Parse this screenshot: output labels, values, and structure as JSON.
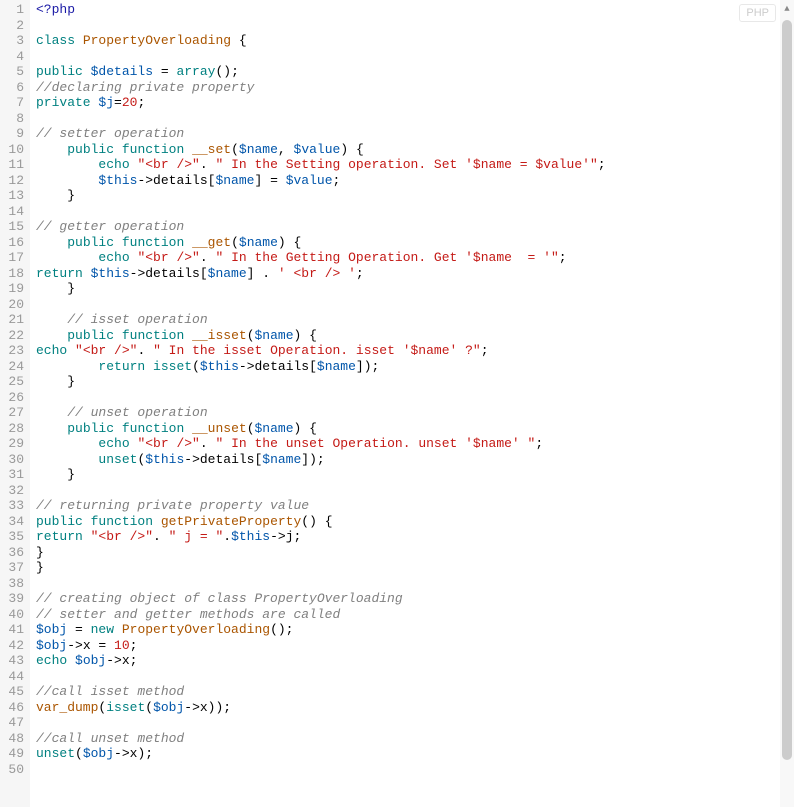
{
  "badge": "PHP",
  "line_count": 50,
  "lines": [
    [
      {
        "c": "t-tag",
        "t": "<?php"
      }
    ],
    [],
    [
      {
        "c": "t-kw",
        "t": "class"
      },
      {
        "t": " "
      },
      {
        "c": "t-fn",
        "t": "PropertyOverloading"
      },
      {
        "t": " {"
      }
    ],
    [],
    [
      {
        "c": "t-kw",
        "t": "public"
      },
      {
        "t": " "
      },
      {
        "c": "t-var",
        "t": "$details"
      },
      {
        "t": " = "
      },
      {
        "c": "t-kw",
        "t": "array"
      },
      {
        "t": "();"
      }
    ],
    [
      {
        "c": "t-com",
        "t": "//declaring private property"
      }
    ],
    [
      {
        "c": "t-kw",
        "t": "private"
      },
      {
        "t": " "
      },
      {
        "c": "t-var",
        "t": "$j"
      },
      {
        "t": "="
      },
      {
        "c": "t-num",
        "t": "20"
      },
      {
        "t": ";"
      }
    ],
    [],
    [
      {
        "c": "t-com",
        "t": "// setter operation"
      }
    ],
    [
      {
        "t": "    "
      },
      {
        "c": "t-kw",
        "t": "public"
      },
      {
        "t": " "
      },
      {
        "c": "t-kw",
        "t": "function"
      },
      {
        "t": " "
      },
      {
        "c": "t-fn",
        "t": "__set"
      },
      {
        "t": "("
      },
      {
        "c": "t-var",
        "t": "$name"
      },
      {
        "t": ", "
      },
      {
        "c": "t-var",
        "t": "$value"
      },
      {
        "t": ") {"
      }
    ],
    [
      {
        "t": "        "
      },
      {
        "c": "t-kw",
        "t": "echo"
      },
      {
        "t": " "
      },
      {
        "c": "t-str",
        "t": "\"<br />\""
      },
      {
        "t": ". "
      },
      {
        "c": "t-str",
        "t": "\" In the Setting operation. Set '$name = $value'\""
      },
      {
        "t": ";"
      }
    ],
    [
      {
        "t": "        "
      },
      {
        "c": "t-var",
        "t": "$this"
      },
      {
        "t": "->details["
      },
      {
        "c": "t-var",
        "t": "$name"
      },
      {
        "t": "] = "
      },
      {
        "c": "t-var",
        "t": "$value"
      },
      {
        "t": ";"
      }
    ],
    [
      {
        "t": "    }"
      }
    ],
    [],
    [
      {
        "c": "t-com",
        "t": "// getter operation"
      }
    ],
    [
      {
        "t": "    "
      },
      {
        "c": "t-kw",
        "t": "public"
      },
      {
        "t": " "
      },
      {
        "c": "t-kw",
        "t": "function"
      },
      {
        "t": " "
      },
      {
        "c": "t-fn",
        "t": "__get"
      },
      {
        "t": "("
      },
      {
        "c": "t-var",
        "t": "$name"
      },
      {
        "t": ") {"
      }
    ],
    [
      {
        "t": "        "
      },
      {
        "c": "t-kw",
        "t": "echo"
      },
      {
        "t": " "
      },
      {
        "c": "t-str",
        "t": "\"<br />\""
      },
      {
        "t": ". "
      },
      {
        "c": "t-str",
        "t": "\" In the Getting Operation. Get '$name  = '\""
      },
      {
        "t": ";"
      }
    ],
    [
      {
        "c": "t-kw",
        "t": "return"
      },
      {
        "t": " "
      },
      {
        "c": "t-var",
        "t": "$this"
      },
      {
        "t": "->details["
      },
      {
        "c": "t-var",
        "t": "$name"
      },
      {
        "t": "] . "
      },
      {
        "c": "t-str",
        "t": "' <br /> '"
      },
      {
        "t": ";"
      }
    ],
    [
      {
        "t": "    }"
      }
    ],
    [],
    [
      {
        "t": "    "
      },
      {
        "c": "t-com",
        "t": "// isset operation"
      }
    ],
    [
      {
        "t": "    "
      },
      {
        "c": "t-kw",
        "t": "public"
      },
      {
        "t": " "
      },
      {
        "c": "t-kw",
        "t": "function"
      },
      {
        "t": " "
      },
      {
        "c": "t-fn",
        "t": "__isset"
      },
      {
        "t": "("
      },
      {
        "c": "t-var",
        "t": "$name"
      },
      {
        "t": ") {"
      }
    ],
    [
      {
        "c": "t-kw",
        "t": "echo"
      },
      {
        "t": " "
      },
      {
        "c": "t-str",
        "t": "\"<br />\""
      },
      {
        "t": ". "
      },
      {
        "c": "t-str",
        "t": "\" In the isset Operation. isset '$name' ?\""
      },
      {
        "t": ";"
      }
    ],
    [
      {
        "t": "        "
      },
      {
        "c": "t-kw",
        "t": "return"
      },
      {
        "t": " "
      },
      {
        "c": "t-kw",
        "t": "isset"
      },
      {
        "t": "("
      },
      {
        "c": "t-var",
        "t": "$this"
      },
      {
        "t": "->details["
      },
      {
        "c": "t-var",
        "t": "$name"
      },
      {
        "t": "]);"
      }
    ],
    [
      {
        "t": "    }"
      }
    ],
    [],
    [
      {
        "t": "    "
      },
      {
        "c": "t-com",
        "t": "// unset operation"
      }
    ],
    [
      {
        "t": "    "
      },
      {
        "c": "t-kw",
        "t": "public"
      },
      {
        "t": " "
      },
      {
        "c": "t-kw",
        "t": "function"
      },
      {
        "t": " "
      },
      {
        "c": "t-fn",
        "t": "__unset"
      },
      {
        "t": "("
      },
      {
        "c": "t-var",
        "t": "$name"
      },
      {
        "t": ") {"
      }
    ],
    [
      {
        "t": "        "
      },
      {
        "c": "t-kw",
        "t": "echo"
      },
      {
        "t": " "
      },
      {
        "c": "t-str",
        "t": "\"<br />\""
      },
      {
        "t": ". "
      },
      {
        "c": "t-str",
        "t": "\" In the unset Operation. unset '$name' \""
      },
      {
        "t": ";"
      }
    ],
    [
      {
        "t": "        "
      },
      {
        "c": "t-kw",
        "t": "unset"
      },
      {
        "t": "("
      },
      {
        "c": "t-var",
        "t": "$this"
      },
      {
        "t": "->details["
      },
      {
        "c": "t-var",
        "t": "$name"
      },
      {
        "t": "]);"
      }
    ],
    [
      {
        "t": "    }"
      }
    ],
    [],
    [
      {
        "c": "t-com",
        "t": "// returning private property value"
      }
    ],
    [
      {
        "c": "t-kw",
        "t": "public"
      },
      {
        "t": " "
      },
      {
        "c": "t-kw",
        "t": "function"
      },
      {
        "t": " "
      },
      {
        "c": "t-fn",
        "t": "getPrivateProperty"
      },
      {
        "t": "() {"
      }
    ],
    [
      {
        "c": "t-kw",
        "t": "return"
      },
      {
        "t": " "
      },
      {
        "c": "t-str",
        "t": "\"<br />\""
      },
      {
        "t": ". "
      },
      {
        "c": "t-str",
        "t": "\" j = \""
      },
      {
        "t": "."
      },
      {
        "c": "t-var",
        "t": "$this"
      },
      {
        "t": "->j;"
      }
    ],
    [
      {
        "t": "}"
      }
    ],
    [
      {
        "t": "}"
      }
    ],
    [],
    [
      {
        "c": "t-com",
        "t": "// creating object of class PropertyOverloading"
      }
    ],
    [
      {
        "c": "t-com",
        "t": "// setter and getter methods are called"
      }
    ],
    [
      {
        "c": "t-var",
        "t": "$obj"
      },
      {
        "t": " = "
      },
      {
        "c": "t-kw",
        "t": "new"
      },
      {
        "t": " "
      },
      {
        "c": "t-fn",
        "t": "PropertyOverloading"
      },
      {
        "t": "();"
      }
    ],
    [
      {
        "c": "t-var",
        "t": "$obj"
      },
      {
        "t": "->x = "
      },
      {
        "c": "t-num",
        "t": "10"
      },
      {
        "t": ";"
      }
    ],
    [
      {
        "c": "t-kw",
        "t": "echo"
      },
      {
        "t": " "
      },
      {
        "c": "t-var",
        "t": "$obj"
      },
      {
        "t": "->x;"
      }
    ],
    [],
    [
      {
        "c": "t-com",
        "t": "//call isset method"
      }
    ],
    [
      {
        "c": "t-fn",
        "t": "var_dump"
      },
      {
        "t": "("
      },
      {
        "c": "t-kw",
        "t": "isset"
      },
      {
        "t": "("
      },
      {
        "c": "t-var",
        "t": "$obj"
      },
      {
        "t": "->x));"
      }
    ],
    [],
    [
      {
        "c": "t-com",
        "t": "//call unset method"
      }
    ],
    [
      {
        "c": "t-kw",
        "t": "unset"
      },
      {
        "t": "("
      },
      {
        "c": "t-var",
        "t": "$obj"
      },
      {
        "t": "->x);"
      }
    ],
    []
  ]
}
